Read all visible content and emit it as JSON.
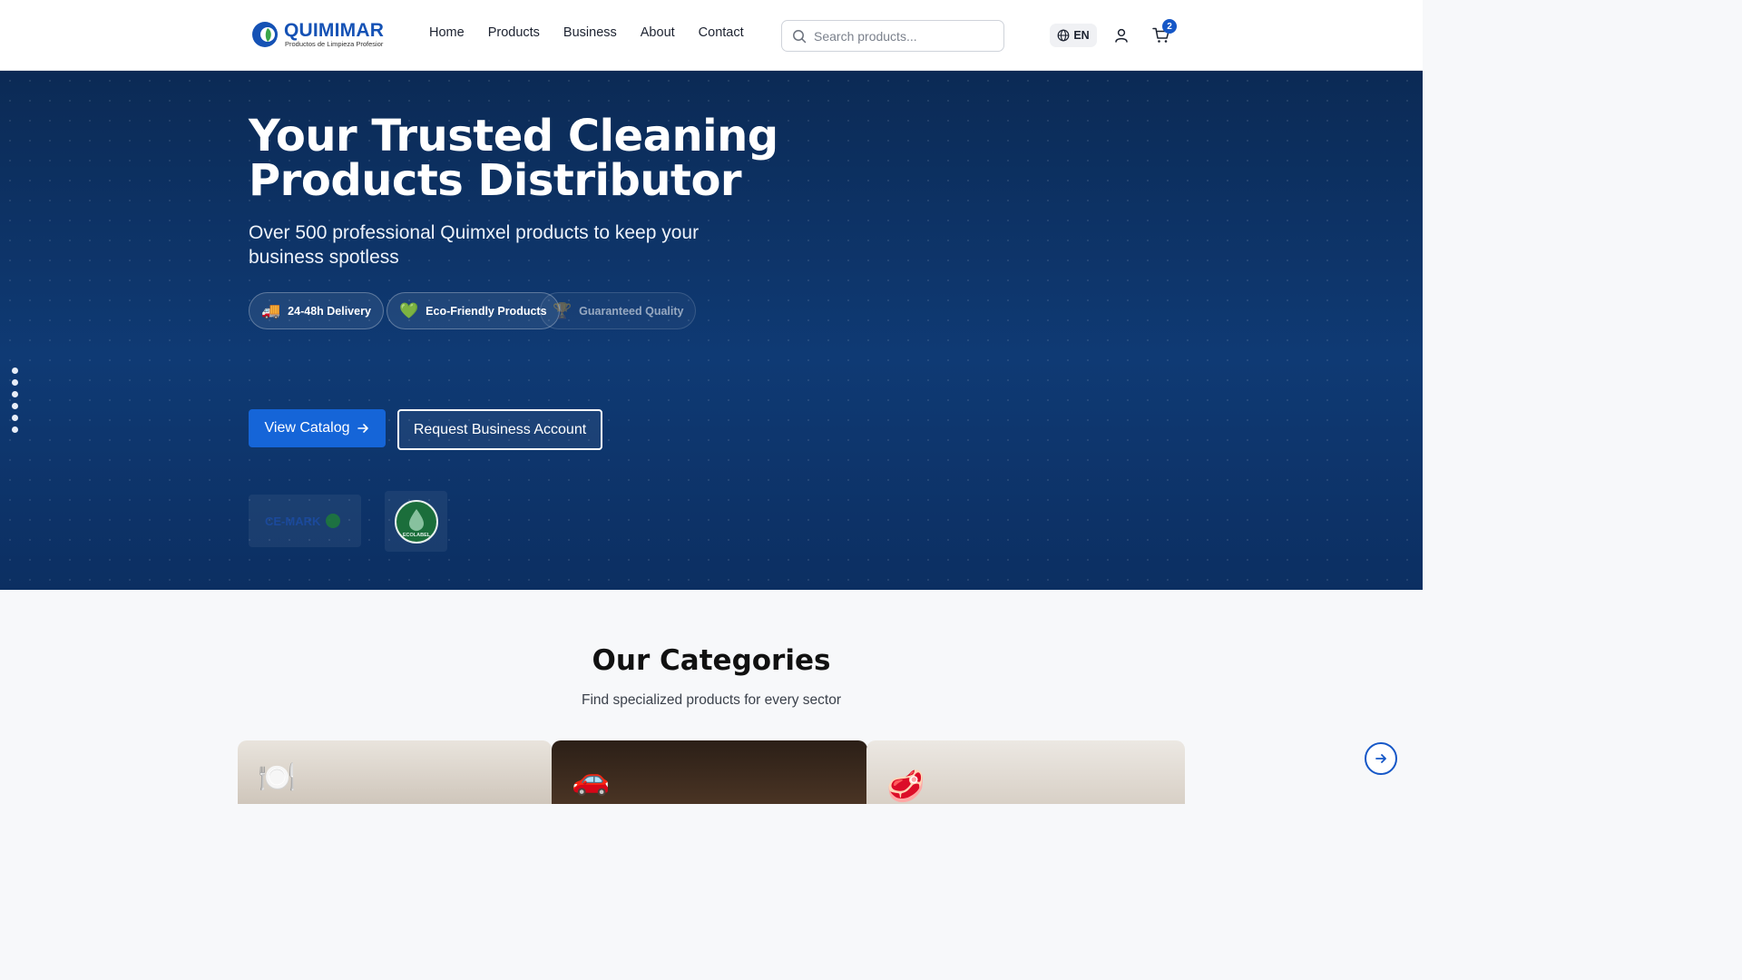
{
  "brand": {
    "name": "QUIMIMAR",
    "tagline": "Productos de Limpieza Profesior",
    "accent": "#1552b5",
    "leaf_color": "#3aa64a"
  },
  "nav": {
    "items": [
      {
        "label": "Home"
      },
      {
        "label": "Products"
      },
      {
        "label": "Business"
      },
      {
        "label": "About"
      },
      {
        "label": "Contact"
      }
    ]
  },
  "search": {
    "placeholder": "Search products...",
    "icon": "search-icon"
  },
  "header_actions": {
    "language": "EN",
    "language_icon": "globe-icon",
    "user_icon": "user-icon",
    "cart_icon": "cart-icon",
    "cart_count": "2"
  },
  "hero": {
    "title": "Your Trusted Cleaning Products Distributor",
    "subtitle": "Over 500 professional Quimxel products to keep your business spotless",
    "features": [
      {
        "icon": "🚚",
        "label": "24-48h Delivery"
      },
      {
        "icon": "💚",
        "label": "Eco-Friendly Products"
      },
      {
        "icon": "🏆",
        "label": "Guaranteed Quality"
      }
    ],
    "primary_cta": "View Catalog",
    "secondary_cta": "Request Business Account",
    "certifications": [
      {
        "label": "CE-MARK"
      },
      {
        "label": "ECOLABEL"
      }
    ],
    "slide_count": 6,
    "background": "#0f3a74"
  },
  "categories": {
    "title": "Our Categories",
    "subtitle": "Find specialized products for every sector",
    "cards": [
      {
        "icon": "🍽️"
      },
      {
        "icon": "🚗"
      },
      {
        "icon": "🥩"
      }
    ],
    "next_icon": "arrow-right-circle-icon"
  }
}
